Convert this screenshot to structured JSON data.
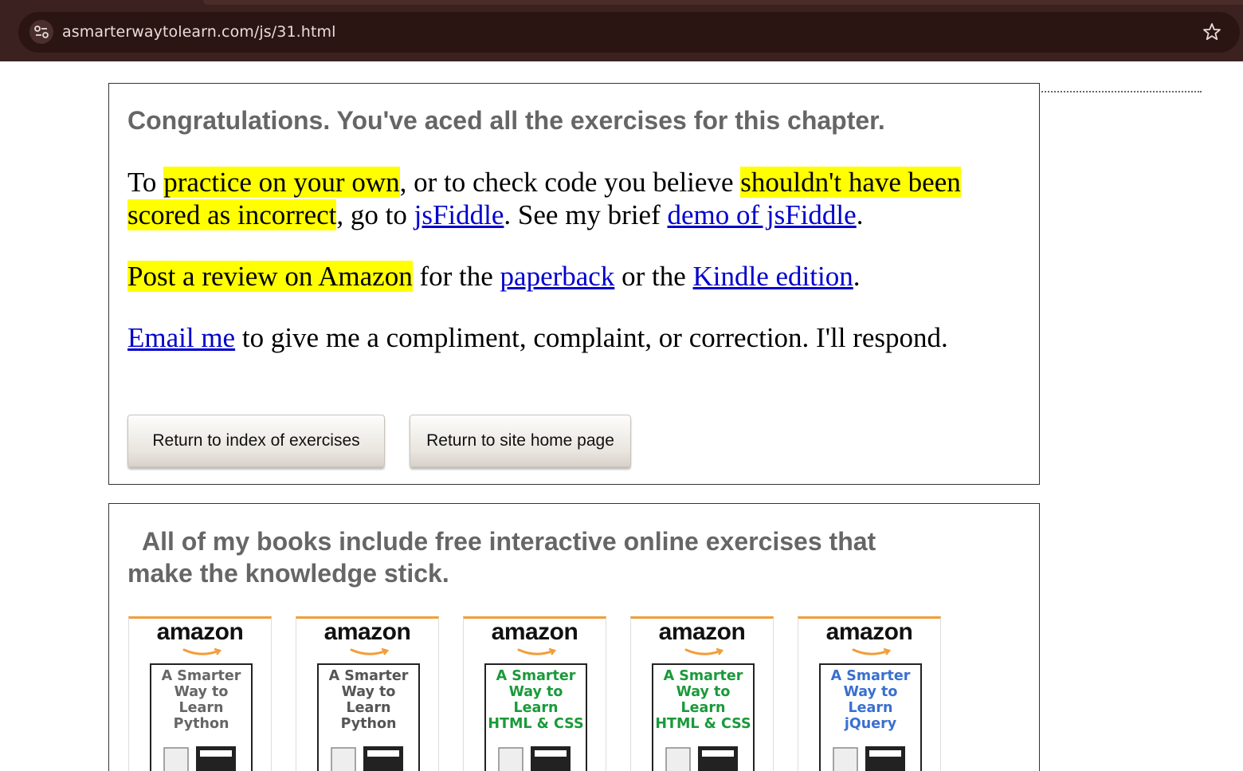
{
  "browser": {
    "url": "asmarterwaytolearn.com/js/31.html",
    "icons": [
      "site-info-icon",
      "bookmark-star-icon"
    ]
  },
  "congrats": {
    "heading": "Congratulations. You've aced all the exercises for this chapter.",
    "practice": {
      "t1": "To ",
      "h1": "practice on your own",
      "t2": ", or to check code you believe ",
      "h2": "shouldn't have been scored as incorrect",
      "t3": ", go to ",
      "link1": "jsFiddle",
      "t4": ". See my brief ",
      "link2": "demo of jsFiddle",
      "t5": "."
    },
    "review": {
      "h1": "Post a review on Amazon",
      "t1": " for the ",
      "link1": "paperback",
      "t2": " or the ",
      "link2": "Kindle edition",
      "t3": "."
    },
    "email": {
      "link": "Email me",
      "text": " to give me a compliment, complaint, or correction. I'll respond."
    },
    "buttons": {
      "index": "Return to index of exercises",
      "home": "Return to site home page"
    }
  },
  "books_section": {
    "heading_line1": "All of my books include free interactive online exercises that",
    "heading_line2": "make the knowledge stick.",
    "books": [
      {
        "brand": "amazon",
        "l1": "A Smarter",
        "l2": "Way to",
        "l3": "Learn",
        "l4": "Python",
        "color": "#666666"
      },
      {
        "brand": "amazon",
        "l1": "A Smarter",
        "l2": "Way to",
        "l3": "Learn",
        "l4": "Python",
        "color": "#555555"
      },
      {
        "brand": "amazon",
        "l1": "A Smarter",
        "l2": "Way to",
        "l3": "Learn",
        "l4": "HTML & CSS",
        "color": "#1a9a3a"
      },
      {
        "brand": "amazon",
        "l1": "A Smarter",
        "l2": "Way to",
        "l3": "Learn",
        "l4": "HTML & CSS",
        "color": "#1a9a3a"
      },
      {
        "brand": "amazon",
        "l1": "A Smarter",
        "l2": "Way to",
        "l3": "Learn",
        "l4": "jQuery",
        "color": "#3a6fd0"
      }
    ]
  },
  "colors": {
    "highlight": "#ffff00",
    "link": "#0000cc",
    "heading": "#666666",
    "chrome_bg": "#3b2220",
    "amazon_orange": "#f19e39"
  }
}
